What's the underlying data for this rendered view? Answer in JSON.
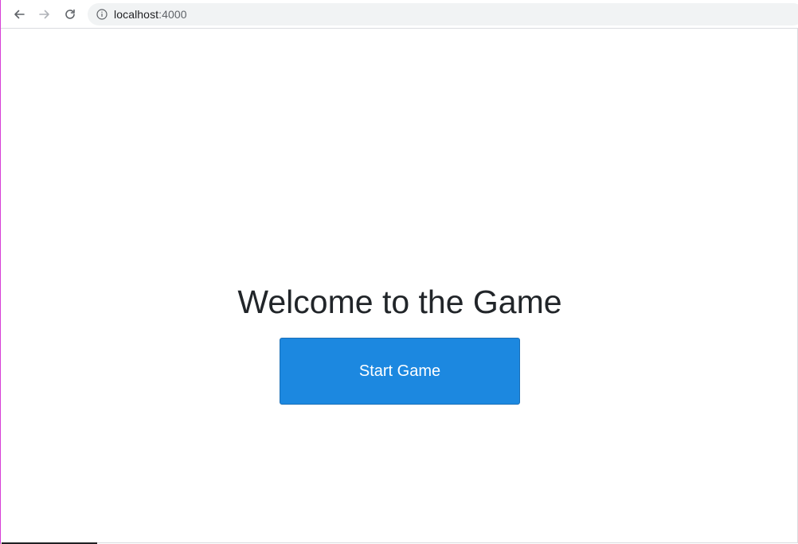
{
  "browser": {
    "url_host": "localhost",
    "url_port": ":4000",
    "icons": {
      "back": "arrow-left-icon",
      "forward": "arrow-right-icon",
      "reload": "reload-icon",
      "site_info": "info-circle-icon"
    }
  },
  "page": {
    "heading": "Welcome to the Game",
    "start_button_label": "Start Game"
  },
  "colors": {
    "button_bg": "#1c88e0",
    "heading_text": "#212529"
  }
}
